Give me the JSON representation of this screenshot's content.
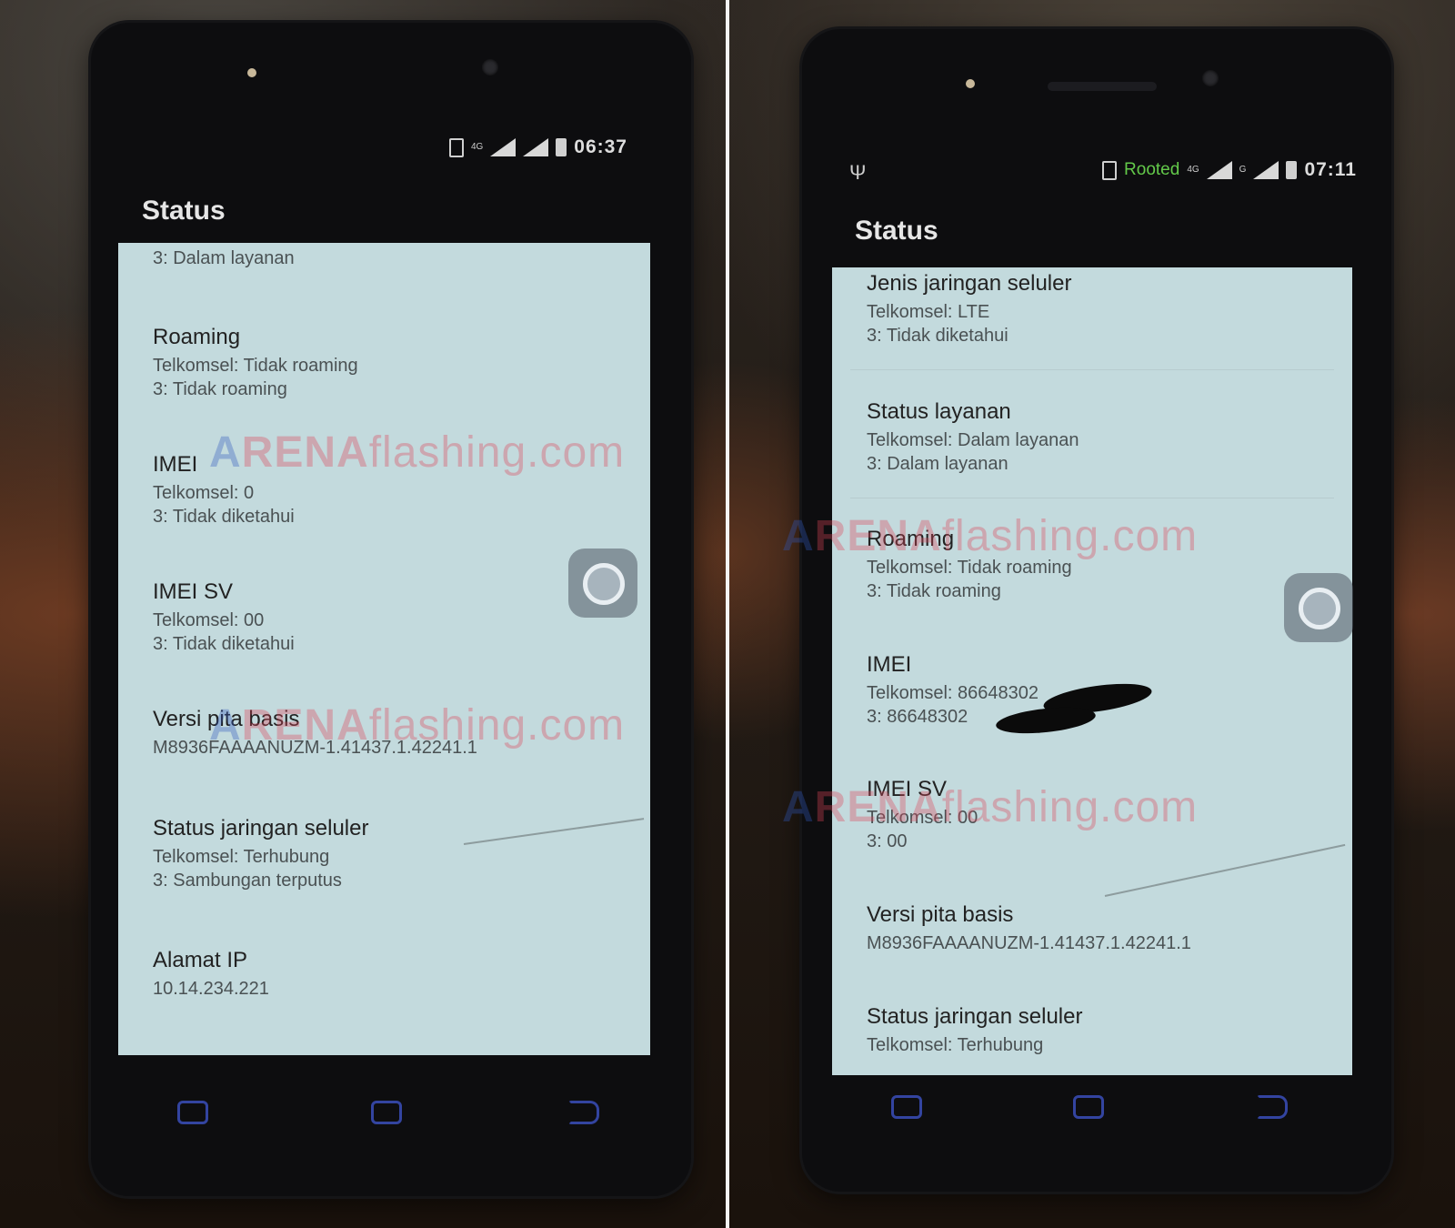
{
  "left": {
    "statusbar": {
      "time": "06:37",
      "net_label": "4G"
    },
    "title": "Status",
    "partial_top": "3: Dalam layanan",
    "items": [
      {
        "label": "Roaming",
        "line1": "Telkomsel: Tidak roaming",
        "line2": "3: Tidak roaming"
      },
      {
        "label": "IMEI",
        "line1": "Telkomsel: 0",
        "line2": "3: Tidak diketahui"
      },
      {
        "label": "IMEI SV",
        "line1": "Telkomsel: 00",
        "line2": "3: Tidak diketahui"
      },
      {
        "label": "Versi pita basis",
        "line1": "M8936FAAAANUZM-1.41437.1.42241.1",
        "line2": ""
      },
      {
        "label": "Status jaringan seluler",
        "line1": "Telkomsel: Terhubung",
        "line2": "3: Sambungan terputus"
      },
      {
        "label": "Alamat IP",
        "line1": "10.14.234.221",
        "line2": ""
      }
    ]
  },
  "right": {
    "statusbar": {
      "time": "07:11",
      "rooted": "Rooted",
      "net_label": "4G",
      "net2_label": "G"
    },
    "title": "Status",
    "items": [
      {
        "label": "Jenis jaringan seluler",
        "line1": "Telkomsel: LTE",
        "line2": "3: Tidak diketahui"
      },
      {
        "label": "Status layanan",
        "line1": "Telkomsel: Dalam layanan",
        "line2": "3: Dalam layanan"
      },
      {
        "label": "Roaming",
        "line1": "Telkomsel: Tidak roaming",
        "line2": "3: Tidak roaming"
      },
      {
        "label": "IMEI",
        "line1": "Telkomsel: 86648302",
        "line2": "3: 86648302"
      },
      {
        "label": "IMEI SV",
        "line1": "Telkomsel: 00",
        "line2": "3: 00"
      },
      {
        "label": "Versi pita basis",
        "line1": "M8936FAAAANUZM-1.41437.1.42241.1",
        "line2": ""
      },
      {
        "label": "Status jaringan seluler",
        "line1": "Telkomsel: Terhubung",
        "line2": ""
      }
    ]
  },
  "watermark": {
    "a": "A",
    "rena": "RENA",
    "domain": "flashing.com"
  },
  "icons": {
    "usb": "usb-icon",
    "sim": "sim-icon",
    "signal": "signal-icon",
    "battery": "battery-icon"
  }
}
